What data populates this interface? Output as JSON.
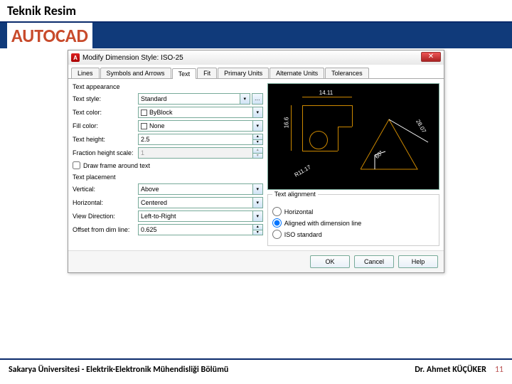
{
  "slide": {
    "course": "Teknik Resim",
    "topic": "AUTOCAD",
    "footer_left": "Sakarya Üniversitesi - Elektrik-Elektronik Mühendisliği Bölümü",
    "footer_right": "Dr. Ahmet KÜÇÜKER",
    "page": "11"
  },
  "dialog": {
    "title": "Modify Dimension Style: ISO-25",
    "tabs": [
      "Lines",
      "Symbols and Arrows",
      "Text",
      "Fit",
      "Primary Units",
      "Alternate Units",
      "Tolerances"
    ],
    "active_tab": 2,
    "text_appearance": {
      "section": "Text appearance",
      "style_label": "Text style:",
      "style_value": "Standard",
      "color_label": "Text color:",
      "color_value": "ByBlock",
      "fill_label": "Fill color:",
      "fill_value": "None",
      "height_label": "Text height:",
      "height_value": "2.5",
      "frac_label": "Fraction height scale:",
      "frac_value": "1",
      "draw_frame": "Draw frame around text"
    },
    "text_placement": {
      "section": "Text placement",
      "vertical_label": "Vertical:",
      "vertical_value": "Above",
      "horizontal_label": "Horizontal:",
      "horizontal_value": "Centered",
      "viewdir_label": "View Direction:",
      "viewdir_value": "Left-to-Right",
      "offset_label": "Offset from dim line:",
      "offset_value": "0.625"
    },
    "text_alignment": {
      "section": "Text alignment",
      "opt_horizontal": "Horizontal",
      "opt_aligned": "Aligned with dimension line",
      "opt_iso": "ISO standard",
      "selected": 1
    },
    "preview": {
      "dim_top": "14.11",
      "dim_left": "16.6",
      "dim_right": "28.07",
      "dim_angle": "60°",
      "dim_radius": "R11.17"
    },
    "buttons": {
      "ok": "OK",
      "cancel": "Cancel",
      "help": "Help"
    }
  }
}
